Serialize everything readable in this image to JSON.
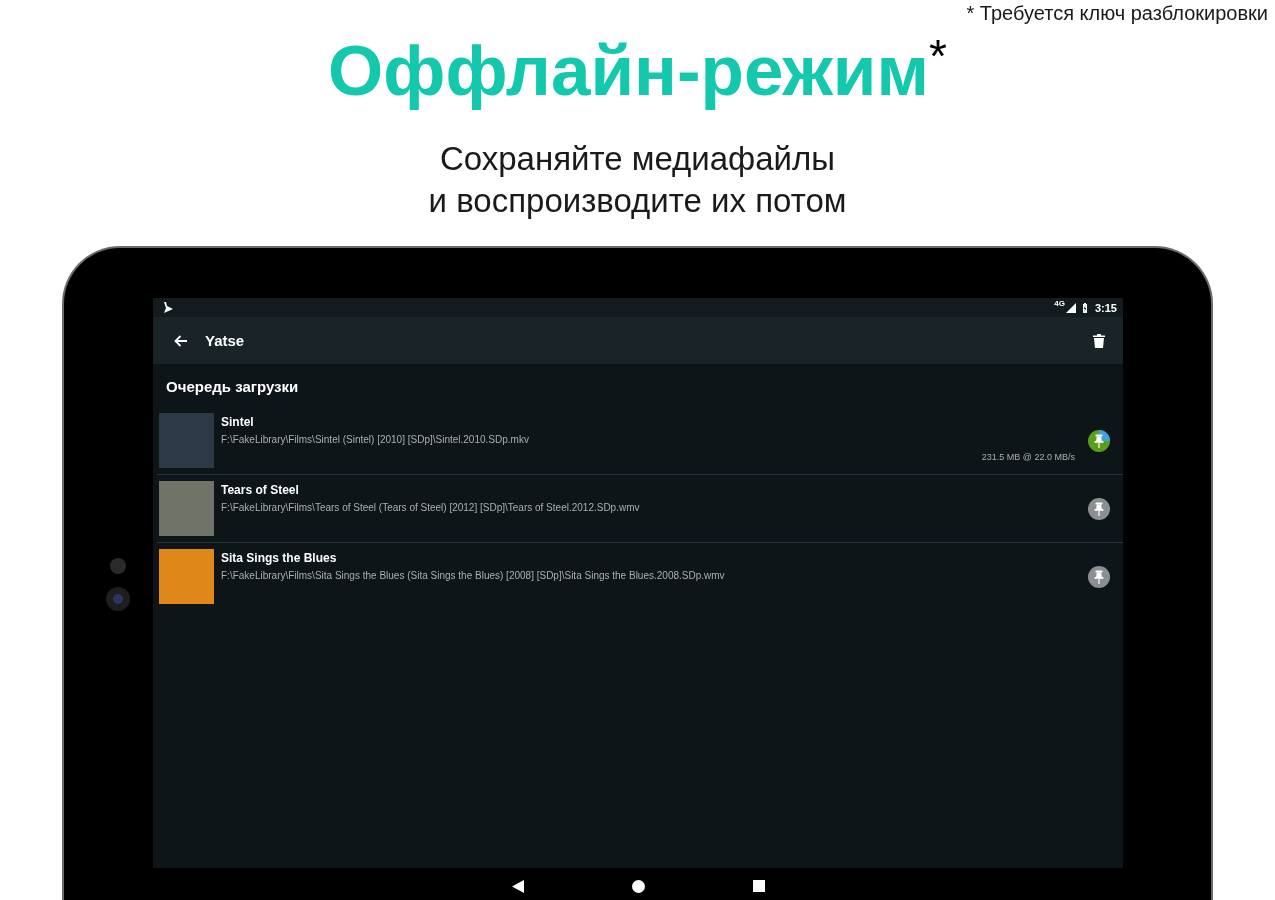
{
  "footnote": "* Требуется ключ разблокировки",
  "headline": "Оффлайн-режим$^{*}$",
  "subtitle": "Сохраняйте медиафайлы\nи воспроизводите их потом",
  "device": {
    "status_bar": {
      "network": "4G",
      "time": "3:15"
    },
    "toolbar": {
      "title": "Yatse"
    },
    "list": {
      "header": "Очередь загрузки",
      "items": [
        {
          "title": "Sintel",
          "path": "F:\\FakeLibrary\\Films\\Sintel (Sintel) [2010] [SDp]\\Sintel.2010.SDp.mkv",
          "progress_text": "231.5 MB @ 22.0 MB/s",
          "active": true,
          "color": "#2c3a48"
        },
        {
          "title": "Tears of Steel",
          "path": "F:\\FakeLibrary\\Films\\Tears of Steel (Tears of Steel) [2012] [SDp]\\Tears of Steel.2012.SDp.wmv",
          "active": false,
          "color": "#6f7368"
        },
        {
          "title": "Sita Sings the Blues",
          "path": "F:\\FakeLibrary\\Films\\Sita Sings the Blues (Sita Sings the Blues) [2008] [SDp]\\Sita Sings the Blues.2008.SDp.wmv",
          "active": false,
          "color": "#e0871a"
        }
      ]
    }
  }
}
